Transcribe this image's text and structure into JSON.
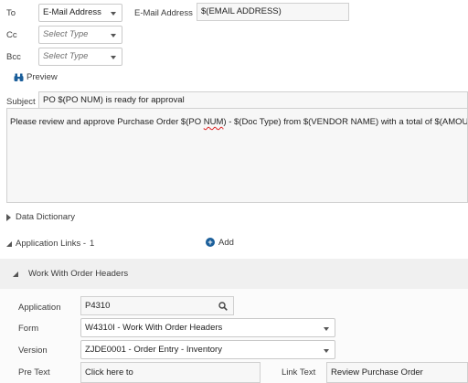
{
  "recipients": {
    "to_label": "To",
    "to_type": "E-Mail Address",
    "email_label": "E-Mail Address",
    "email_value": "$(EMAIL ADDRESS)",
    "cc_label": "Cc",
    "cc_placeholder": "Select Type",
    "bcc_label": "Bcc",
    "bcc_placeholder": "Select Type"
  },
  "preview_label": "Preview",
  "subject": {
    "label": "Subject",
    "value": "PO $(PO NUM) is ready for approval"
  },
  "body": {
    "part1": "Please review and approve Purchase Order $(PO ",
    "part2": "NUM",
    "part3": ") - $(Doc Type) from $(VENDOR NAME) with a total of $(AMOUNT)."
  },
  "data_dictionary_label": "Data Dictionary",
  "application_links": {
    "label": "Application Links -",
    "count": "1",
    "add_label": "Add"
  },
  "link_panel": {
    "title": "Work With Order Headers",
    "application_label": "Application",
    "application_value": "P4310",
    "form_label": "Form",
    "form_value": "W4310I - Work With Order Headers",
    "version_label": "Version",
    "version_value": "ZJDE0001 - Order Entry - Inventory",
    "pretext_label": "Pre Text",
    "pretext_value": "Click here to",
    "linktext_label": "Link Text",
    "linktext_value": "Review Purchase Order"
  },
  "colors": {
    "accent": "#1a5e9a",
    "panel_band": "#f0f0f0",
    "spellcheck": "#dd2222"
  }
}
